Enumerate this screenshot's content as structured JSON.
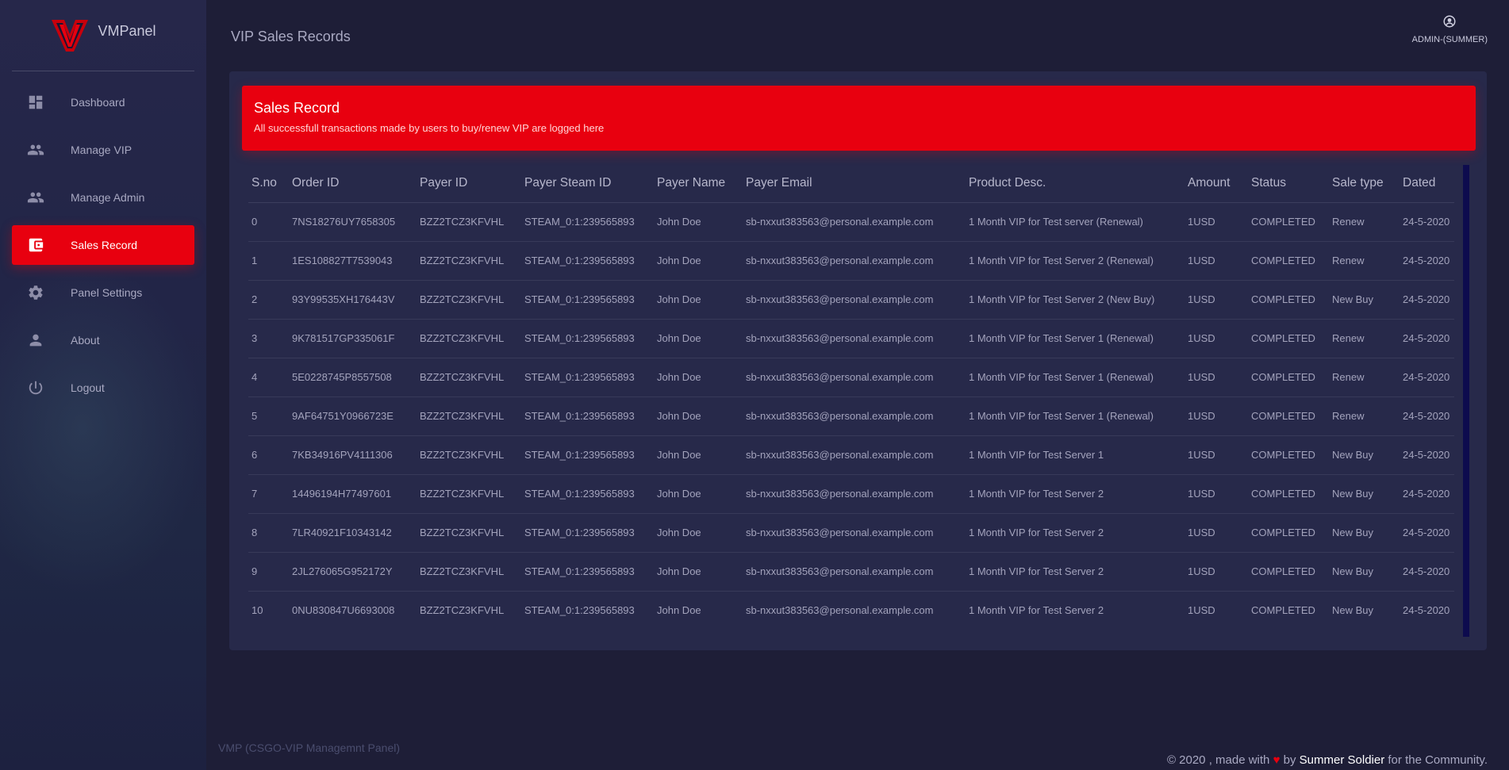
{
  "brand": {
    "name": "VMPanel",
    "logo_icon": "vmp-logo"
  },
  "sidebar": {
    "items": [
      {
        "label": "Dashboard",
        "icon": "dashboard-icon"
      },
      {
        "label": "Manage VIP",
        "icon": "people-icon"
      },
      {
        "label": "Manage Admin",
        "icon": "people-icon"
      },
      {
        "label": "Sales Record",
        "icon": "wallet-icon",
        "active": true
      },
      {
        "label": "Panel Settings",
        "icon": "gear-icon"
      },
      {
        "label": "About",
        "icon": "person-icon"
      },
      {
        "label": "Logout",
        "icon": "power-icon"
      }
    ]
  },
  "header": {
    "title": "VIP Sales Records",
    "user": {
      "label": "ADMIN-(SUMMER)",
      "icon": "user-icon"
    }
  },
  "card": {
    "title": "Sales Record",
    "subtitle": "All successfull transactions made by users to buy/renew VIP are logged here"
  },
  "table": {
    "columns": [
      "S.no",
      "Order ID",
      "Payer ID",
      "Payer Steam ID",
      "Payer Name",
      "Payer Email",
      "Product Desc.",
      "Amount",
      "Status",
      "Sale type",
      "Dated"
    ],
    "rows": [
      [
        "0",
        "7NS18276UY7658305",
        "BZZ2TCZ3KFVHL",
        "STEAM_0:1:239565893",
        "John Doe",
        "sb-nxxut383563@personal.example.com",
        "1 Month VIP for Test server (Renewal)",
        "1USD",
        "COMPLETED",
        "Renew",
        "24-5-2020"
      ],
      [
        "1",
        "1ES108827T7539043",
        "BZZ2TCZ3KFVHL",
        "STEAM_0:1:239565893",
        "John Doe",
        "sb-nxxut383563@personal.example.com",
        "1 Month VIP for Test Server 2 (Renewal)",
        "1USD",
        "COMPLETED",
        "Renew",
        "24-5-2020"
      ],
      [
        "2",
        "93Y99535XH176443V",
        "BZZ2TCZ3KFVHL",
        "STEAM_0:1:239565893",
        "John Doe",
        "sb-nxxut383563@personal.example.com",
        "1 Month VIP for Test Server 2 (New Buy)",
        "1USD",
        "COMPLETED",
        "New Buy",
        "24-5-2020"
      ],
      [
        "3",
        "9K781517GP335061F",
        "BZZ2TCZ3KFVHL",
        "STEAM_0:1:239565893",
        "John Doe",
        "sb-nxxut383563@personal.example.com",
        "1 Month VIP for Test Server 1 (Renewal)",
        "1USD",
        "COMPLETED",
        "Renew",
        "24-5-2020"
      ],
      [
        "4",
        "5E0228745P8557508",
        "BZZ2TCZ3KFVHL",
        "STEAM_0:1:239565893",
        "John Doe",
        "sb-nxxut383563@personal.example.com",
        "1 Month VIP for Test Server 1 (Renewal)",
        "1USD",
        "COMPLETED",
        "Renew",
        "24-5-2020"
      ],
      [
        "5",
        "9AF64751Y0966723E",
        "BZZ2TCZ3KFVHL",
        "STEAM_0:1:239565893",
        "John Doe",
        "sb-nxxut383563@personal.example.com",
        "1 Month VIP for Test Server 1 (Renewal)",
        "1USD",
        "COMPLETED",
        "Renew",
        "24-5-2020"
      ],
      [
        "6",
        "7KB34916PV4111306",
        "BZZ2TCZ3KFVHL",
        "STEAM_0:1:239565893",
        "John Doe",
        "sb-nxxut383563@personal.example.com",
        "1 Month VIP for Test Server 1",
        "1USD",
        "COMPLETED",
        "New Buy",
        "24-5-2020"
      ],
      [
        "7",
        "14496194H77497601",
        "BZZ2TCZ3KFVHL",
        "STEAM_0:1:239565893",
        "John Doe",
        "sb-nxxut383563@personal.example.com",
        "1 Month VIP for Test Server 2",
        "1USD",
        "COMPLETED",
        "New Buy",
        "24-5-2020"
      ],
      [
        "8",
        "7LR40921F10343142",
        "BZZ2TCZ3KFVHL",
        "STEAM_0:1:239565893",
        "John Doe",
        "sb-nxxut383563@personal.example.com",
        "1 Month VIP for Test Server 2",
        "1USD",
        "COMPLETED",
        "New Buy",
        "24-5-2020"
      ],
      [
        "9",
        "2JL276065G952172Y",
        "BZZ2TCZ3KFVHL",
        "STEAM_0:1:239565893",
        "John Doe",
        "sb-nxxut383563@personal.example.com",
        "1 Month VIP for Test Server 2",
        "1USD",
        "COMPLETED",
        "New Buy",
        "24-5-2020"
      ],
      [
        "10",
        "0NU830847U6693008",
        "BZZ2TCZ3KFVHL",
        "STEAM_0:1:239565893",
        "John Doe",
        "sb-nxxut383563@personal.example.com",
        "1 Month VIP for Test Server 2",
        "1USD",
        "COMPLETED",
        "New Buy",
        "24-5-2020"
      ]
    ]
  },
  "footer": {
    "left": "VMP (CSGO-VIP Managemnt Panel)",
    "copyright": "© 2020 , made with",
    "heart": "♥",
    "by": "by",
    "author": "Summer Soldier",
    "suffix": "for the Community."
  },
  "colors": {
    "accent": "#e8000f",
    "background": "#1e1e37",
    "card": "#27294a",
    "sidebar": "#232548"
  }
}
